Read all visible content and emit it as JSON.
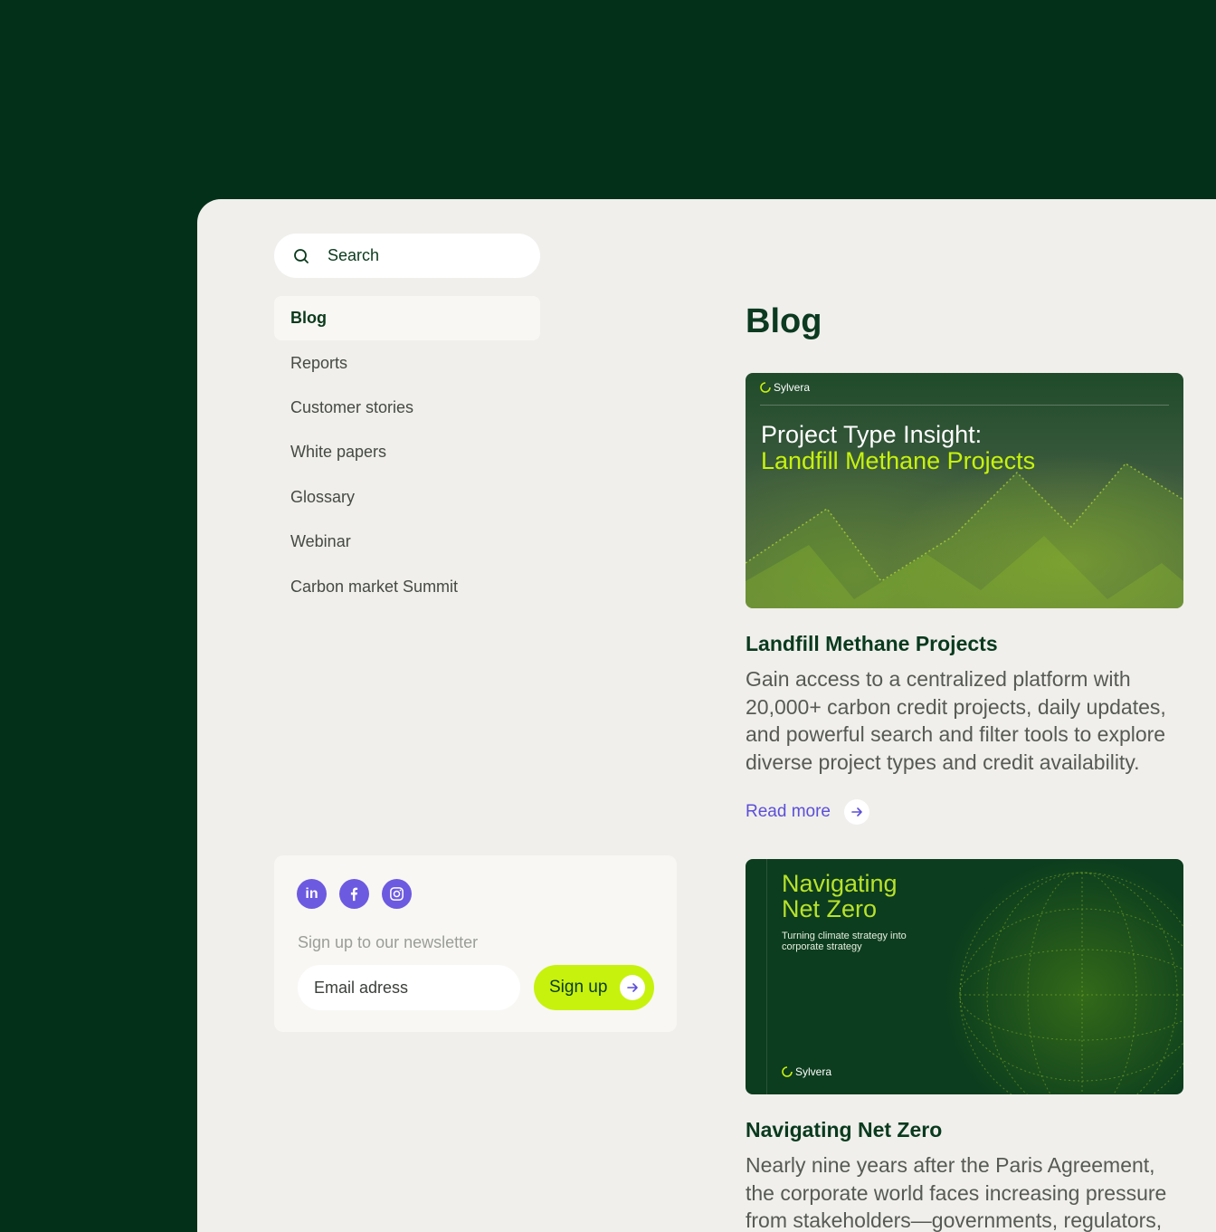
{
  "search": {
    "label": "Search"
  },
  "nav": {
    "items": [
      {
        "label": "Blog",
        "active": true
      },
      {
        "label": "Reports"
      },
      {
        "label": "Customer stories"
      },
      {
        "label": "White papers"
      },
      {
        "label": "Glossary"
      },
      {
        "label": "Webinar"
      },
      {
        "label": "Carbon market Summit"
      }
    ]
  },
  "newsletter": {
    "socials": [
      "linkedin-icon",
      "facebook-icon",
      "instagram-icon"
    ],
    "linkedin_text": "in",
    "label": "Sign up to our newsletter",
    "email_placeholder": "Email adress",
    "signup_label": "Sign up"
  },
  "main": {
    "page_title": "Blog",
    "posts": [
      {
        "image": {
          "brand": "Sylvera",
          "title_line1": "Project Type Insight:",
          "title_line2": "Landfill Methane Projects"
        },
        "title": "Landfill Methane Projects",
        "body": "Gain access to a centralized platform with 20,000+ carbon credit projects, daily updates, and powerful search and filter tools to explore diverse project types and credit availability.",
        "read_more": "Read more"
      },
      {
        "image": {
          "brand": "Sylvera",
          "title": "Navigating Net Zero",
          "subtitle": "Turning climate strategy into corporate strategy"
        },
        "title": "Navigating Net Zero",
        "body": "Nearly nine years after the Paris Agreement, the corporate world faces increasing pressure from stakeholders—governments, regulators,"
      }
    ]
  },
  "colors": {
    "background": "#033019",
    "panel": "#f0efeb",
    "accent_lime": "#c7f20d",
    "accent_purple": "#6c5ae0",
    "link": "#5b4fd8",
    "heading": "#093a1e"
  }
}
